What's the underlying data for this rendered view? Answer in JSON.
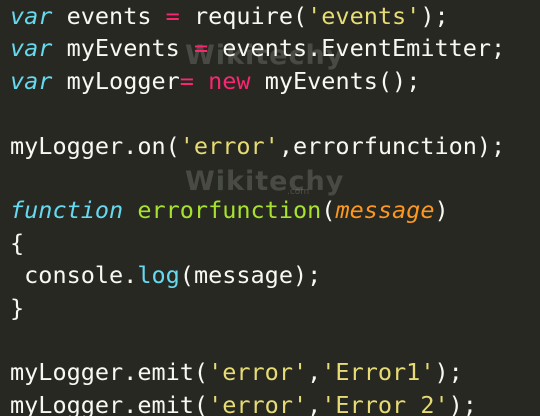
{
  "watermark": {
    "text": "Wikitechy",
    "domain": ".com"
  },
  "code": {
    "l1": {
      "kw": "var",
      "a": " events ",
      "op": "=",
      "b": " require(",
      "str": "'events'",
      "c": ");"
    },
    "l2": {
      "kw": "var",
      "a": " myEvents ",
      "op": "=",
      "b": " events.EventEmitter;"
    },
    "l3": {
      "kw": "var",
      "a": " myLogger",
      "op": "=",
      "sp": " ",
      "new": "new",
      "b": " myEvents();"
    },
    "l5": {
      "a": "myLogger.on(",
      "str": "'error'",
      "b": ",errorfunction);"
    },
    "l7": {
      "kw": "function",
      "sp": " ",
      "fn": "errorfunction",
      "p1": "(",
      "param": "message",
      "p2": ")"
    },
    "l8": "{",
    "l9": {
      "a": " console.",
      "method": "log",
      "b": "(message);"
    },
    "l10": "}",
    "l12": {
      "a": "myLogger.emit(",
      "s1": "'error'",
      "c": ",",
      "s2": "'Error1'",
      "b": ");"
    },
    "l13": {
      "a": "myLogger.emit(",
      "s1": "'error'",
      "c": ",",
      "s2": "'Error 2'",
      "b": ");"
    }
  },
  "colors": {
    "background": "#272822",
    "keyword": "#66d9ef",
    "string": "#e6db74",
    "function_name": "#a6e22e",
    "parameter": "#fd971f",
    "operator": "#f92672",
    "text": "#f8f8f2"
  }
}
